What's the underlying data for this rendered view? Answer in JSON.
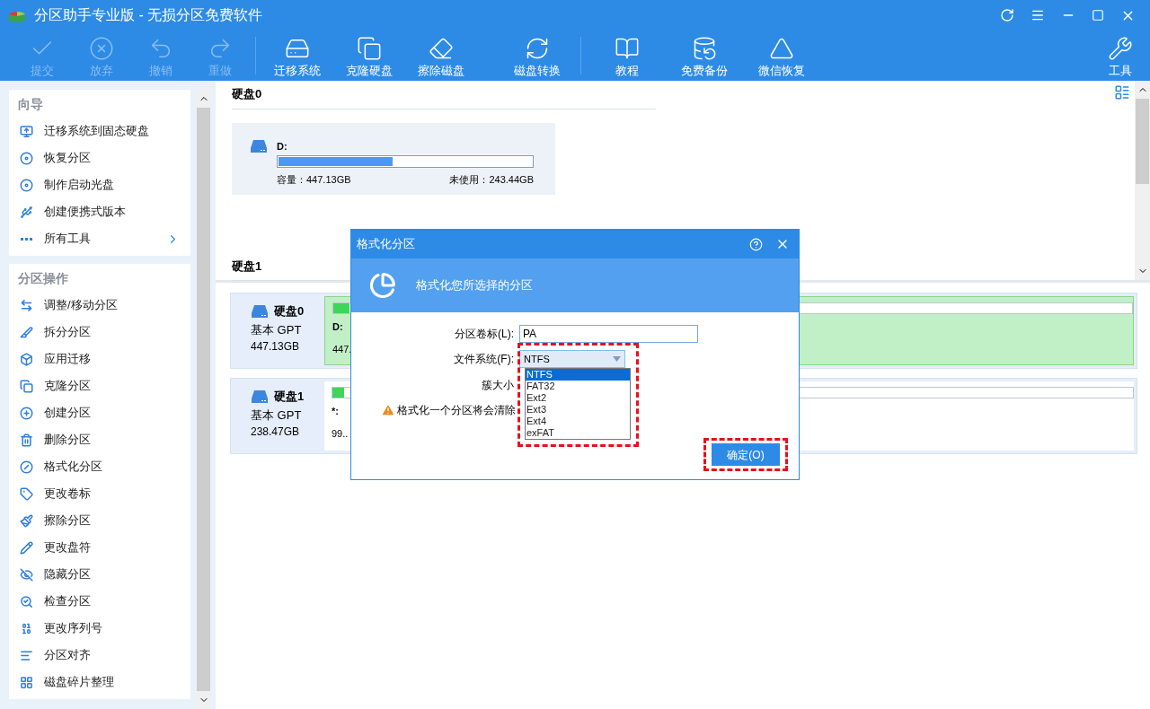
{
  "window": {
    "title": "分区助手专业版 - 无损分区免费软件"
  },
  "toolbar": [
    {
      "label": "提交",
      "disabled": true
    },
    {
      "label": "放弃",
      "disabled": true
    },
    {
      "label": "撤销",
      "disabled": true
    },
    {
      "label": "重做",
      "disabled": true
    },
    {
      "label": "迁移系统",
      "disabled": false
    },
    {
      "label": "克隆硬盘",
      "disabled": false
    },
    {
      "label": "擦除磁盘",
      "disabled": false
    },
    {
      "label": "磁盘转换",
      "disabled": false
    },
    {
      "label": "教程",
      "disabled": false
    },
    {
      "label": "免费备份",
      "disabled": false
    },
    {
      "label": "微信恢复",
      "disabled": false
    },
    {
      "label": "工具",
      "disabled": false
    }
  ],
  "sidebar": [
    {
      "title": "向导",
      "items": [
        {
          "label": "迁移系统到固态硬盘",
          "kind": "command"
        },
        {
          "label": "恢复分区",
          "kind": "command"
        },
        {
          "label": "制作启动光盘",
          "kind": "command"
        },
        {
          "label": "创建便携式版本",
          "kind": "command"
        },
        {
          "label": "所有工具",
          "kind": "submenu"
        }
      ]
    },
    {
      "title": "分区操作",
      "items": [
        {
          "label": "调整/移动分区",
          "kind": "command"
        },
        {
          "label": "拆分分区",
          "kind": "command"
        },
        {
          "label": "应用迁移",
          "kind": "command"
        },
        {
          "label": "克隆分区",
          "kind": "command"
        },
        {
          "label": "创建分区",
          "kind": "command"
        },
        {
          "label": "删除分区",
          "kind": "command"
        },
        {
          "label": "格式化分区",
          "kind": "command"
        },
        {
          "label": "更改卷标",
          "kind": "command"
        },
        {
          "label": "擦除分区",
          "kind": "command"
        },
        {
          "label": "更改盘符",
          "kind": "command"
        },
        {
          "label": "隐藏分区",
          "kind": "command"
        },
        {
          "label": "检查分区",
          "kind": "command"
        },
        {
          "label": "更改序列号",
          "kind": "command"
        },
        {
          "label": "分区对齐",
          "kind": "command"
        },
        {
          "label": "磁盘碎片整理",
          "kind": "command"
        }
      ]
    }
  ],
  "disk_cards": [
    {
      "title": "硬盘0",
      "partitions": [
        {
          "name": "D:",
          "level": 0.45,
          "capacity": "容量：447.13GB",
          "free": "未使用：243.44GB"
        }
      ]
    },
    {
      "title": "硬盘1"
    }
  ],
  "disk_rows": [
    {
      "name": "硬盘0",
      "type": "基本 GPT",
      "size": "447.13GB",
      "partition": {
        "label": "D:",
        "info": "447.",
        "level": 0.02,
        "selected": true
      }
    },
    {
      "name": "硬盘1",
      "type": "基本 GPT",
      "size": "238.47GB",
      "partition": {
        "label": "*:",
        "info": "99..",
        "level": 0.015,
        "selected": false
      }
    }
  ],
  "dialog": {
    "title": "格式化分区",
    "heading": "格式化您所选择的分区",
    "volume_label": {
      "label": "分区卷标(L):",
      "value": "PA"
    },
    "file_system": {
      "label": "文件系统(F):",
      "value": "NTFS",
      "expanded": true,
      "options": [
        {
          "label": "NTFS",
          "selected": true
        },
        {
          "label": "FAT32",
          "selected": false
        },
        {
          "label": "Ext2",
          "selected": false
        },
        {
          "label": "Ext3",
          "selected": false
        },
        {
          "label": "Ext4",
          "selected": false
        },
        {
          "label": "exFAT",
          "selected": false
        }
      ]
    },
    "cluster_size": {
      "label": "簇大小"
    },
    "warning": "格式化一个分区将会清除",
    "ok_button": "确定(O)"
  }
}
